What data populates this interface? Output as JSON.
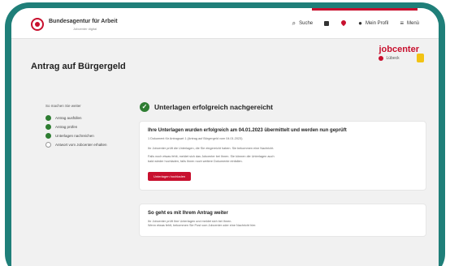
{
  "header": {
    "org_name": "Bundesagentur für Arbeit",
    "org_sub": "Jobcenter digital",
    "nav": {
      "search": "Suche",
      "profile": "Mein Profil",
      "menu": "Menü"
    }
  },
  "page": {
    "title": "Antrag auf Bürgergeld"
  },
  "jobcenter": {
    "name": "jobcenter",
    "city": "Lübeck"
  },
  "steps": {
    "heading": "So machen Sie weiter",
    "items": [
      {
        "label": "Antrag ausfüllen",
        "done": true
      },
      {
        "label": "Antrag prüfen",
        "done": true
      },
      {
        "label": "Unterlagen nachreichen",
        "done": true
      },
      {
        "label": "Antwort vom Jobcenter erhalten",
        "done": false
      }
    ]
  },
  "main": {
    "success_title": "Unterlagen erfolgreich nachgereicht",
    "card1": {
      "title": "Ihre Unterlagen wurden erfolgreich am 04.01.2023 übermittelt und werden nun geprüft",
      "lines": [
        "1 Dokument für Antragsart 1 (Antrag auf Bürgergeld vom 04.01.2023)"
      ],
      "para1": [
        "Ihr Jobcenter prüft die Unterlagen, die Sie eingereicht haben. Sie bekommen eine Nachricht."
      ],
      "para2": [
        "Falls noch etwas fehlt, meldet sich das Jobcenter bei Ihnen. Sie können die Unterlagen auch",
        "bald wieder hochladen, falls Ihnen noch weitere Dokumente einfallen."
      ],
      "button": "Unterlagen hochladen"
    },
    "card2": {
      "title": "So geht es mit Ihrem Antrag weiter",
      "lines": [
        "Ihr Jobcenter prüft Ihre Unterlagen und meldet sich bei Ihnen.",
        "Wenn etwas fehlt, bekommen Sie Post vom Jobcenter oder eine Nachricht hier."
      ]
    }
  },
  "colors": {
    "frame": "#1f7f79",
    "brand_red": "#c8102e",
    "success_green": "#2e7d32"
  }
}
